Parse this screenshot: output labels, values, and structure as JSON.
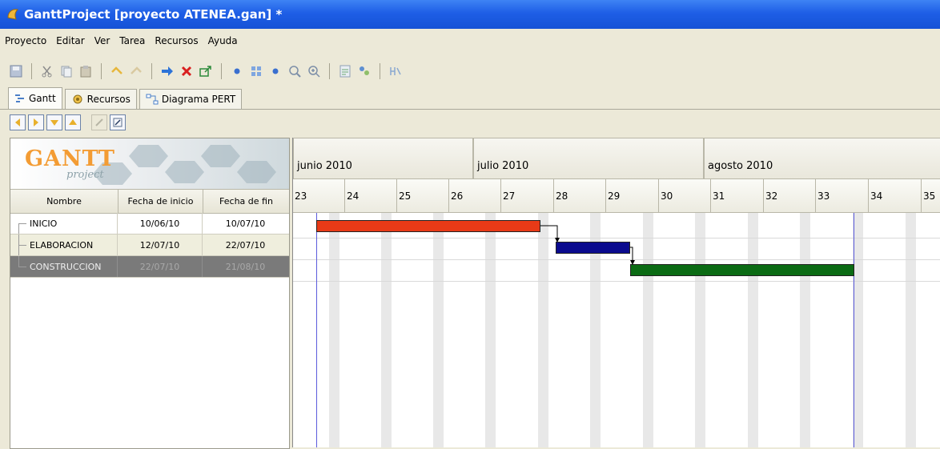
{
  "window": {
    "title": "GanttProject [proyecto ATENEA.gan] *"
  },
  "menu": [
    "Proyecto",
    "Editar",
    "Ver",
    "Tarea",
    "Recursos",
    "Ayuda"
  ],
  "tabs": [
    {
      "label": "Gantt",
      "icon": "gantt-icon",
      "active": true
    },
    {
      "label": "Recursos",
      "icon": "resources-icon",
      "active": false
    },
    {
      "label": "Diagrama PERT",
      "icon": "pert-icon",
      "active": false
    }
  ],
  "logo": {
    "title": "GANTT",
    "subtitle": "project"
  },
  "grid": {
    "headers": {
      "name": "Nombre",
      "start": "Fecha de inicio",
      "end": "Fecha de fin"
    },
    "rows": [
      {
        "name": "INICIO",
        "start": "10/06/10",
        "end": "10/07/10"
      },
      {
        "name": "ELABORACION",
        "start": "12/07/10",
        "end": "22/07/10"
      },
      {
        "name": "CONSTRUCCION",
        "start": "22/07/10",
        "end": "21/08/10"
      }
    ]
  },
  "timeline": {
    "months": [
      "junio 2010",
      "julio 2010",
      "agosto 2010"
    ],
    "weeks": [
      "23",
      "24",
      "25",
      "26",
      "27",
      "28",
      "29",
      "30",
      "31",
      "32",
      "33",
      "34",
      "35"
    ]
  },
  "colors": {
    "task1": "#e83a17",
    "task2": "#0a0a8e",
    "task3": "#0b6b14",
    "today_line": "#5b5bdc"
  }
}
